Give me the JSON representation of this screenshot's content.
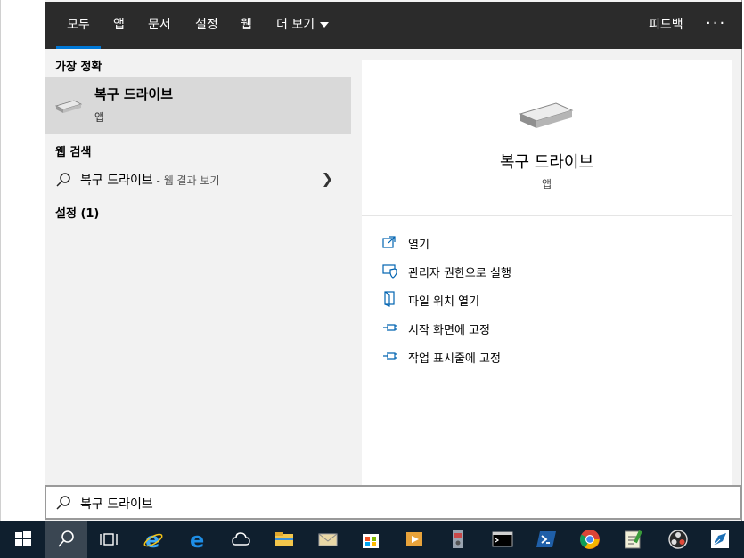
{
  "tabs": [
    {
      "label": "모두",
      "active": true
    },
    {
      "label": "앱"
    },
    {
      "label": "문서"
    },
    {
      "label": "설정"
    },
    {
      "label": "웹"
    },
    {
      "label": "더 보기"
    }
  ],
  "header": {
    "feedback": "피드백",
    "more": "···"
  },
  "results": {
    "best_match_header": "가장 정확",
    "best_match": {
      "title": "복구 드라이브",
      "type": "앱"
    },
    "web_header": "웹 검색",
    "web_item": {
      "query": "복구 드라이브",
      "hint": " - 웹 결과 보기"
    },
    "settings_header": "설정 (1)"
  },
  "detail": {
    "title": "복구 드라이브",
    "type": "앱",
    "actions": [
      {
        "label": "열기",
        "icon": "open-icon"
      },
      {
        "label": "관리자 권한으로 실행",
        "icon": "shield-icon"
      },
      {
        "label": "파일 위치 열기",
        "icon": "file-location-icon"
      },
      {
        "label": "시작 화면에 고정",
        "icon": "pin-icon"
      },
      {
        "label": "작업 표시줄에 고정",
        "icon": "pin-icon"
      }
    ]
  },
  "search": {
    "value": "복구 드라이브"
  },
  "taskbar": {
    "apps": [
      "start-icon",
      "search-icon",
      "task-view-icon",
      "internet-explorer-icon",
      "edge-icon",
      "cloud-icon",
      "file-explorer-icon",
      "mail-icon",
      "store-icon",
      "media-icon",
      "device-icon",
      "cmd-icon",
      "powershell-icon",
      "chrome-icon",
      "notepad-icon",
      "obs-icon",
      "pen-icon"
    ]
  },
  "colors": {
    "accent": "#0078d7",
    "header_bg": "#2b2b2b",
    "panel_bg": "#f2f2f2",
    "taskbar_bg": "#0f1f2e"
  }
}
